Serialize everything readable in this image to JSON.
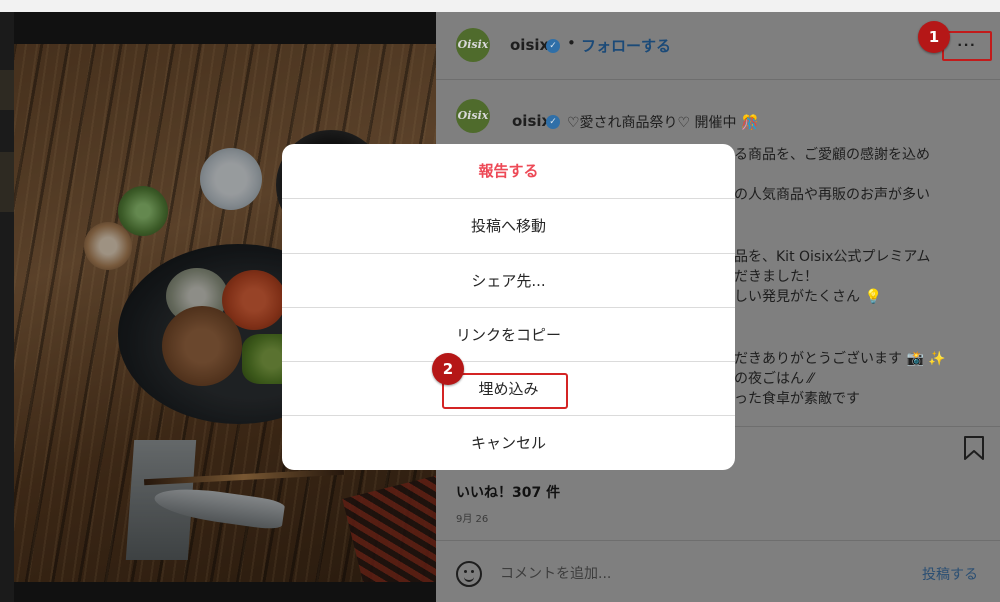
{
  "post": {
    "username": "oisix",
    "avatar_text": "Oisix",
    "verified_icon": "✓",
    "separator": "•",
    "follow_label": "フォローする",
    "more_label": "···",
    "caption_lines": [
      "♡愛され商品祭り♡ 開催中 🎊",
      "る商品を、ご愛顧の感謝を込め",
      "の人気商品や再販のお声が多い",
      "品を、Kit Oisix公式プレミアム",
      "だきました！",
      "しい発見がたくさん 💡",
      "だきありがとうございます 📸 ✨",
      "の夜ごはん ⁄⁄",
      "った食卓が素敵です"
    ],
    "likes": "いいね！307 件",
    "date": "9月 26",
    "comment_placeholder": "コメントを追加...",
    "post_button": "投稿する"
  },
  "modal": {
    "items": [
      {
        "label": "報告する",
        "style": "danger"
      },
      {
        "label": "投稿へ移動",
        "style": "normal"
      },
      {
        "label": "シェア先...",
        "style": "normal"
      },
      {
        "label": "リンクをコピー",
        "style": "normal"
      },
      {
        "label": "埋め込み",
        "style": "normal"
      },
      {
        "label": "キャンセル",
        "style": "normal"
      }
    ]
  },
  "annotations": {
    "step1": "1",
    "step2": "2",
    "highlight_color": "#d42424"
  },
  "colors": {
    "danger": "#ed4956",
    "link": "#1b4a78",
    "overlay": "#7f7f7f"
  }
}
